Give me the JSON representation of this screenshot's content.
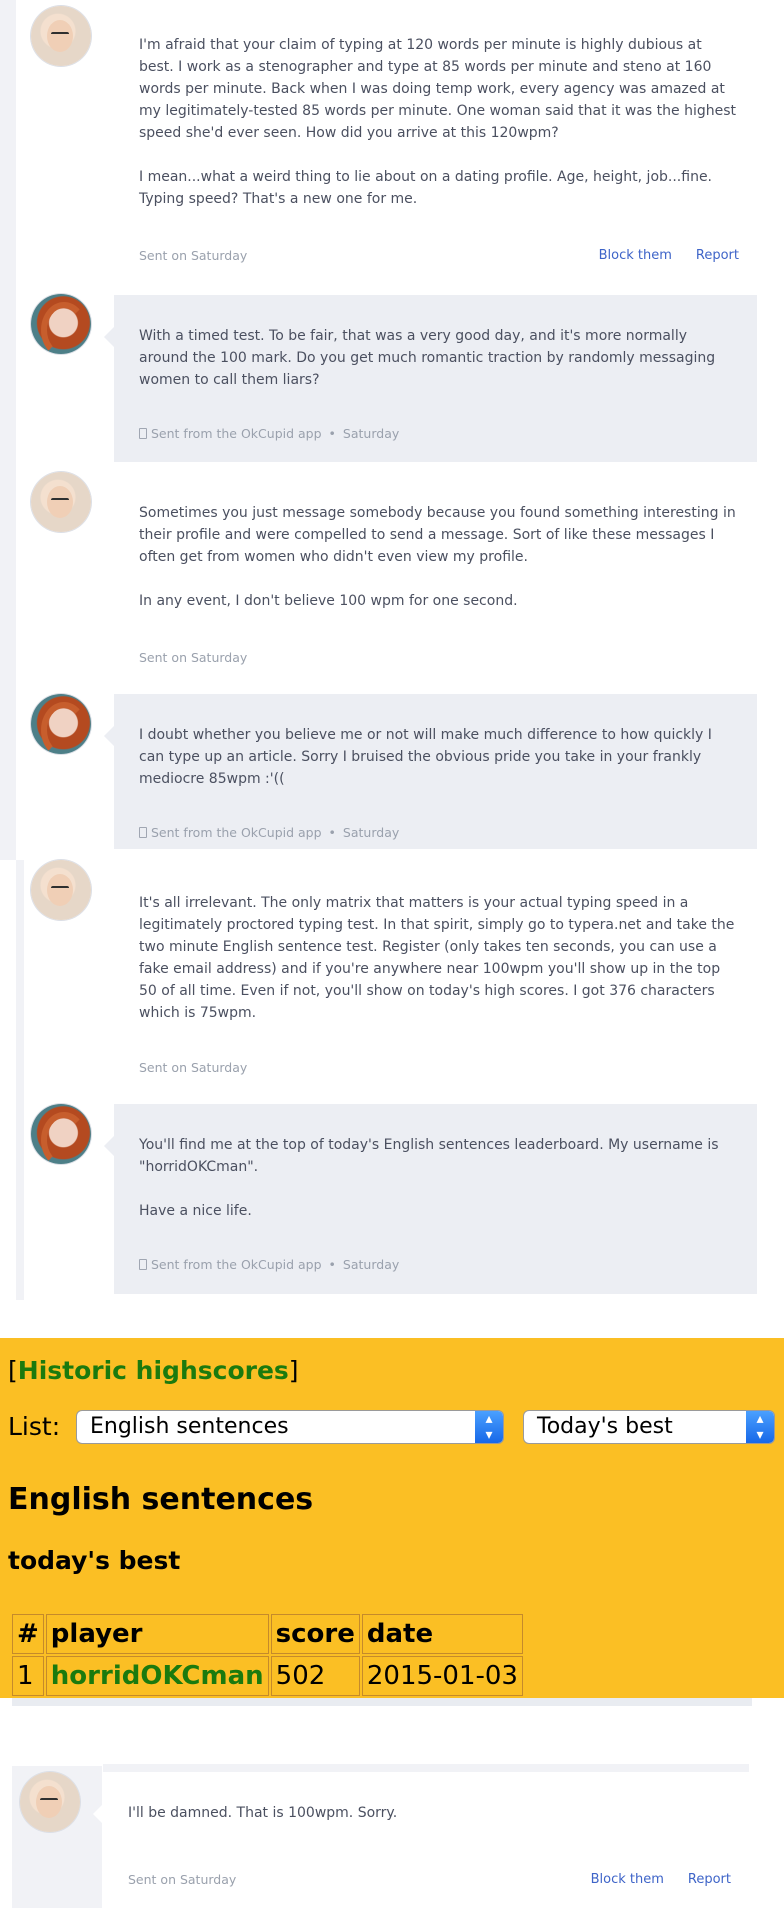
{
  "messages": [
    {
      "from": "them",
      "text": "I'm afraid that your claim of typing at 120 words per minute is highly dubious at best. I work as a stenographer and type at 85 words per minute and steno at 160 words per minute. Back when I was doing temp work, every agency was amazed at my legitimately-tested 85 words per minute. One woman said that it was the highest speed she'd ever seen. How did you arrive at this 120wpm?\n\nI mean...what a weird thing to lie about on a dating profile. Age, height, job...fine. Typing speed? That's a new one for me.",
      "sent": "Sent on Saturday",
      "block": "Block them",
      "report": "Report"
    },
    {
      "from": "me",
      "text": "With a timed test. To be fair, that was a very good day, and it's more normally around the 100 mark. Do you get much romantic traction by randomly messaging women to call them liars?",
      "app": "Sent from the OkCupid app",
      "sep": "•",
      "day": "Saturday"
    },
    {
      "from": "them",
      "text": "Sometimes you just message somebody because you found something interesting in their profile and were compelled to send a message. Sort of like these messages I often get from women who didn't even view my profile.\n\nIn any event, I don't believe 100 wpm for one second.",
      "sent": "Sent on Saturday"
    },
    {
      "from": "me",
      "text": "I doubt whether you believe me or not will make much difference to how quickly I can type up an article. Sorry I bruised the obvious pride you take in your frankly mediocre 85wpm :'((",
      "app": "Sent from the OkCupid app",
      "sep": "•",
      "day": "Saturday"
    },
    {
      "from": "them",
      "text": "It's all irrelevant. The only matrix that matters is your actual typing speed in a legitimately proctored typing test. In that spirit, simply go to typera.net and take the two minute English sentence test. Register (only takes ten seconds, you can use a fake email address) and if you're anywhere near 100wpm you'll show up in the top 50 of all time. Even if not, you'll show on today's high scores. I got 376 characters which is 75wpm.",
      "sent": "Sent on Saturday"
    },
    {
      "from": "me",
      "text": "You'll find me at the top of today's English sentences leaderboard. My username is \"horridOKCman\".\n\nHave a nice life.",
      "app": "Sent from the OkCupid app",
      "sep": "•",
      "day": "Saturday"
    },
    {
      "from": "them",
      "text": "I'll be damned. That is 100wpm. Sorry.",
      "sent": "Sent on Saturday",
      "block": "Block them",
      "report": "Report"
    }
  ],
  "highscores": {
    "bracket_open": "[",
    "link": "Historic highscores",
    "bracket_close": "]",
    "list_label": "List:",
    "select_list": "English sentences",
    "select_period": "Today's best",
    "heading": "English sentences",
    "subheading": "today's best",
    "columns": [
      "#",
      "player",
      "score",
      "date"
    ],
    "rows": [
      {
        "rank": "1",
        "player": "horridOKCman",
        "score": "502",
        "date": "2015-01-03"
      }
    ]
  },
  "colors": {
    "highscore_bg": "#fbbf24",
    "link_green": "#1b7a0e",
    "link_blue": "#3e64c8",
    "bubble_me": "#eceef3"
  }
}
